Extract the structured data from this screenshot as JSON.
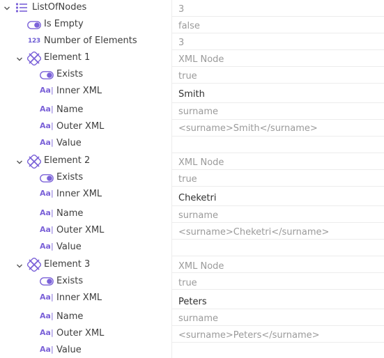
{
  "root": {
    "label": "ListOfNodes",
    "value": "3",
    "icon": "list-icon",
    "children": [
      {
        "label": "Is Empty",
        "value": "false",
        "icon": "toggle-icon"
      },
      {
        "label": "Number of Elements",
        "value": "3",
        "icon": "number-icon",
        "icon_text": "123"
      }
    ]
  },
  "elements": [
    {
      "label": "Element 1",
      "type_value": "XML Node",
      "icon": "xml-node-icon",
      "props": [
        {
          "label": "Exists",
          "value": "true",
          "icon": "toggle-icon"
        },
        {
          "label": "Inner XML",
          "value": "Smith",
          "icon": "text-icon"
        },
        {
          "label": "Name",
          "value": "surname",
          "icon": "text-icon"
        },
        {
          "label": "Outer XML",
          "value": "<surname>Smith</surname>",
          "icon": "text-icon"
        },
        {
          "label": "Value",
          "value": "",
          "icon": "text-icon"
        }
      ]
    },
    {
      "label": "Element 2",
      "type_value": "XML Node",
      "icon": "xml-node-icon",
      "props": [
        {
          "label": "Exists",
          "value": "true",
          "icon": "toggle-icon"
        },
        {
          "label": "Inner XML",
          "value": "Cheketri",
          "icon": "text-icon"
        },
        {
          "label": "Name",
          "value": "surname",
          "icon": "text-icon"
        },
        {
          "label": "Outer XML",
          "value": "<surname>Cheketri</surname>",
          "icon": "text-icon"
        },
        {
          "label": "Value",
          "value": "",
          "icon": "text-icon"
        }
      ]
    },
    {
      "label": "Element 3",
      "type_value": "XML Node",
      "icon": "xml-node-icon",
      "props": [
        {
          "label": "Exists",
          "value": "true",
          "icon": "toggle-icon"
        },
        {
          "label": "Inner XML",
          "value": "Peters",
          "icon": "text-icon"
        },
        {
          "label": "Name",
          "value": "surname",
          "icon": "text-icon"
        },
        {
          "label": "Outer XML",
          "value": "<surname>Peters</surname>",
          "icon": "text-icon"
        },
        {
          "label": "Value",
          "value": "",
          "icon": "text-icon"
        }
      ]
    }
  ],
  "text_icon_glyph": "Aa",
  "colors": {
    "accent": "#7b62d8",
    "muted_text": "#9a9a9a",
    "separator": "#ececec"
  }
}
